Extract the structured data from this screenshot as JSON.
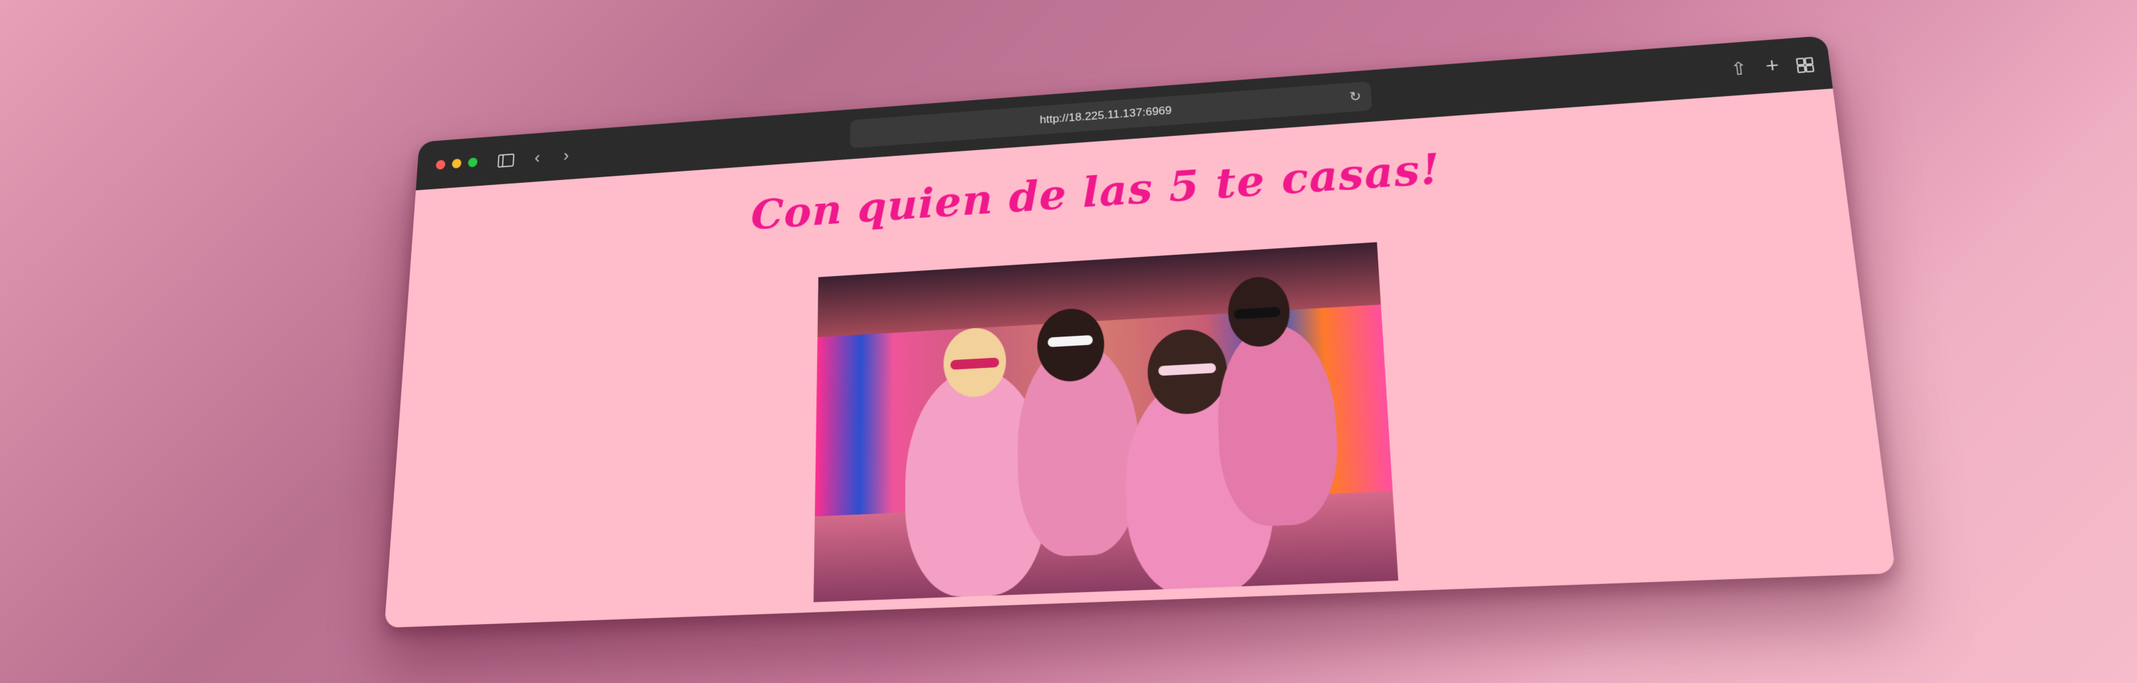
{
  "browser": {
    "url": "http://18.225.11.137:6969",
    "icons": {
      "sidebar": "sidebar-icon",
      "back": "chevron-left-icon",
      "forward": "chevron-right-icon",
      "reload": "reload-icon",
      "share": "share-icon",
      "new_tab": "plus-icon",
      "tab_overview": "tab-grid-icon"
    },
    "traffic_lights": [
      "#fe5f57",
      "#febc2e",
      "#28c840"
    ]
  },
  "page": {
    "heading": "Con quien de las 5 te casas!",
    "heading_color": "#f0188c",
    "background_color": "#ffbccb",
    "hero_image": "photo-five-women-in-pink-jumpsuits-and-sunglasses"
  }
}
